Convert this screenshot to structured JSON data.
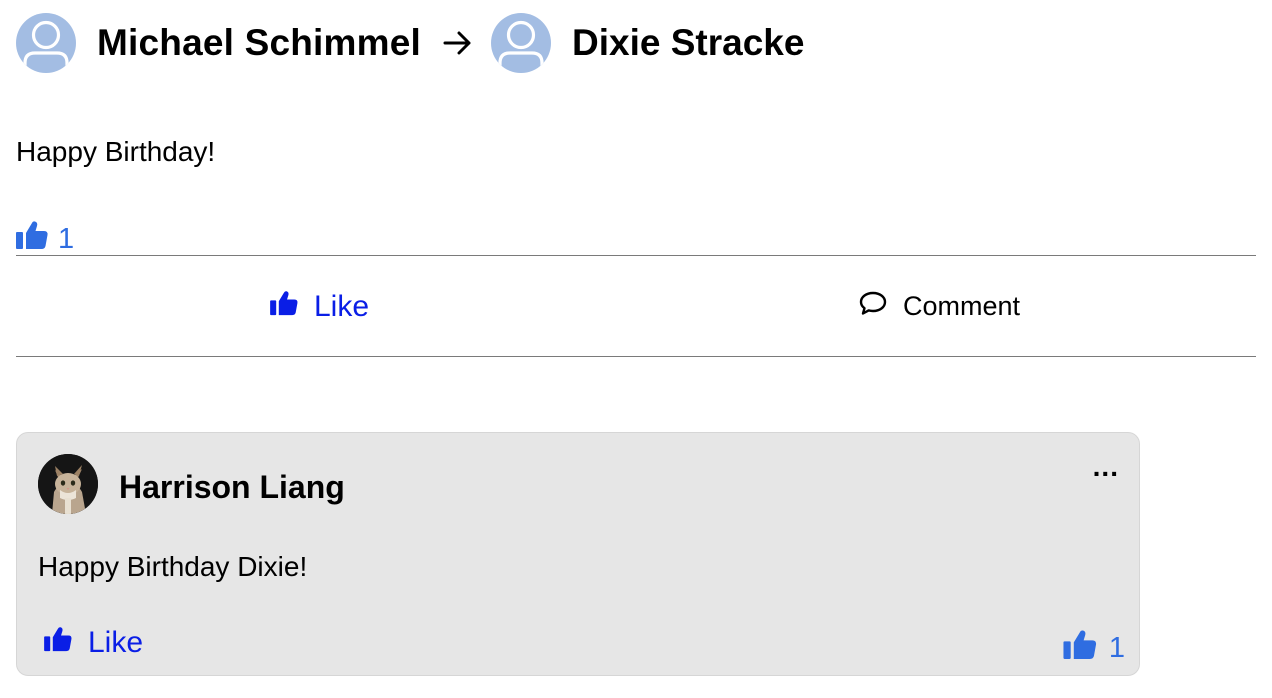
{
  "post": {
    "author": "Michael Schimmel",
    "recipient": "Dixie Stracke",
    "body": "Happy Birthday!",
    "like_count": "1",
    "actions": {
      "like_label": "Like",
      "comment_label": "Comment"
    }
  },
  "comments": [
    {
      "author": "Harrison Liang",
      "text": "Happy Birthday Dixie!",
      "more_label": "...",
      "like_label": "Like",
      "like_count": "1"
    }
  ],
  "colors": {
    "action_blue": "#0a1ee6",
    "reaction_blue": "#2f6de1",
    "avatar_placeholder": "#a3bde3",
    "comment_bg": "#e6e6e6"
  },
  "icons": [
    "default-avatar-icon",
    "arrow-right-icon",
    "thumbs-up-icon",
    "comment-bubble-icon",
    "more-options-icon"
  ]
}
